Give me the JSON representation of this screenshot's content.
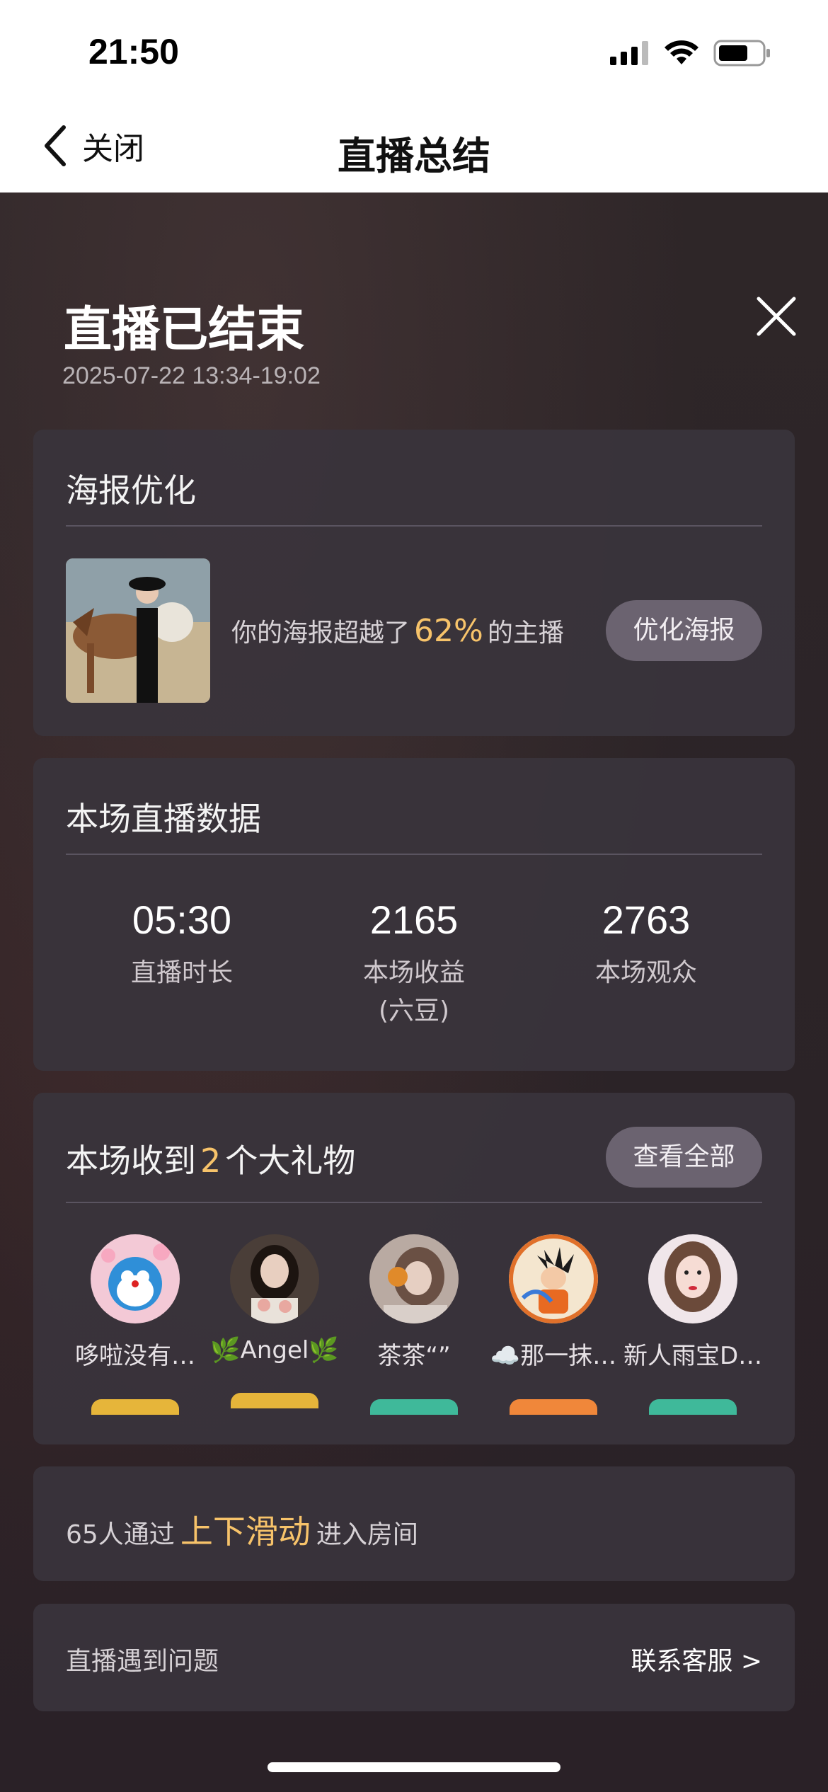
{
  "status_bar": {
    "time": "21:50"
  },
  "nav": {
    "back_label": "关闭",
    "title": "直播总结"
  },
  "summary": {
    "title": "直播已结束",
    "time_range": "2025-07-22 13:34-19:02"
  },
  "poster": {
    "title": "海报优化",
    "text_prefix": "你的海报超越了",
    "percent": "62%",
    "text_suffix": "的主播",
    "button": "优化海报"
  },
  "stats": {
    "title": "本场直播数据",
    "items": [
      {
        "value": "05:30",
        "label": "直播时长"
      },
      {
        "value": "2165",
        "label": "本场收益\n(六豆)"
      },
      {
        "value": "2763",
        "label": "本场观众"
      }
    ]
  },
  "gifts": {
    "title_prefix": "本场收到",
    "count": "2",
    "title_suffix": "个大礼物",
    "button": "查看全部",
    "users": [
      {
        "name": "哆啦没有…",
        "badge_color": "#e6b53a"
      },
      {
        "name": "🌿Angel🌿",
        "badge_color": "#e6b53a"
      },
      {
        "name": "茶茶“”",
        "badge_color": "#3fb99a"
      },
      {
        "name": "☁️那一抹…",
        "badge_color": "#f0873a"
      },
      {
        "name": "新人雨宝D…",
        "badge_color": "#3fb99a"
      }
    ]
  },
  "swipe": {
    "prefix": "65人通过",
    "highlight": "上下滑动",
    "suffix": "进入房间"
  },
  "problem": {
    "label": "直播遇到问题",
    "link": "联系客服 >"
  },
  "colors": {
    "accent": "#f7c36a",
    "card": "#3a343c",
    "button": "#6b6370"
  }
}
